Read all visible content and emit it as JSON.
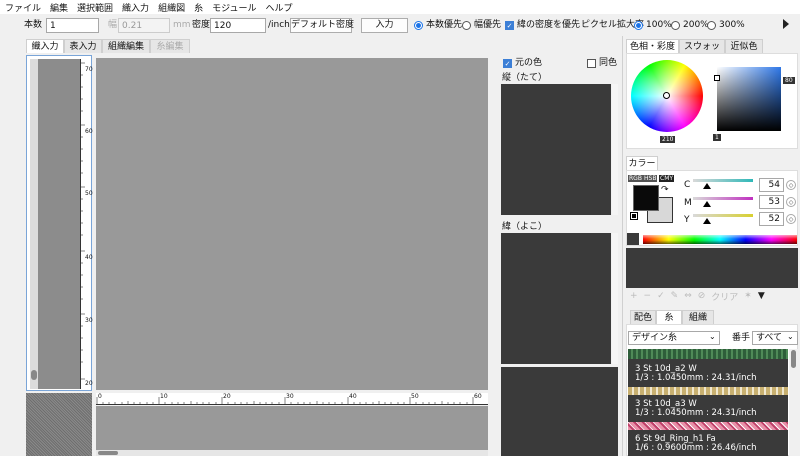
{
  "menu": [
    "ファイル",
    "編集",
    "選択範囲",
    "織入力",
    "組織図",
    "糸",
    "モジュール",
    "ヘルプ"
  ],
  "toolbar": {
    "count_label": "本数",
    "count_value": "1",
    "width_label": "幅",
    "width_value": "0.21",
    "width_unit": "mm",
    "density_label": "密度",
    "density_value": "120",
    "density_unit": "/inch",
    "default_density_btn": "デフォルト密度",
    "input_btn": "入力",
    "count_priority": "本数優先",
    "width_priority": "幅優先",
    "prefer_warp_density": "緯の密度を優先",
    "pixel_zoom_label": "ピクセル拡大率",
    "zoom_options": [
      "100%",
      "200%",
      "300%"
    ]
  },
  "tabs": [
    "織入力",
    "表入力",
    "組織編集",
    "糸編集"
  ],
  "ruler_v": [
    "70",
    "60",
    "50",
    "40",
    "30",
    "20"
  ],
  "ruler_h": [
    "0",
    "10",
    "20",
    "30",
    "40",
    "50",
    "60"
  ],
  "options": {
    "original_color": "元の色",
    "same_color": "同色"
  },
  "yarn_labels": {
    "warp": "縦（たて）",
    "weft": "緯（よこ）"
  },
  "color_tabs": [
    "色相・彩度",
    "スウォッチ",
    "近似色"
  ],
  "hue_value": "210",
  "sv_top": "80",
  "sv_bottom": "1",
  "color_section": "カラー",
  "modes": [
    "RGB",
    "HSB",
    "CMY"
  ],
  "cmy": [
    {
      "label": "C",
      "value": "54"
    },
    {
      "label": "M",
      "value": "53"
    },
    {
      "label": "Y",
      "value": "52"
    }
  ],
  "swatch_clear": "クリア",
  "bottom_tabs": [
    "配色",
    "糸",
    "組織"
  ],
  "yarn_type": "デザイン糸",
  "order_label": "番手",
  "order_value": "すべて",
  "yarn_list": [
    {
      "name": "3 St 10d_a2 W",
      "detail": "1/3 : 1.0450mm : 24.31/inch"
    },
    {
      "name": "3 St 10d_a3 W",
      "detail": "1/3 : 1.0450mm : 24.31/inch"
    },
    {
      "name": "6 St 9d_Ring_h1 Fa",
      "detail": "1/6 : 0.9600mm : 26.46/inch"
    }
  ],
  "colors": {
    "canvas": "#9a9a9a",
    "dark": "#3a3a3a",
    "accent": "#1a73e8"
  }
}
